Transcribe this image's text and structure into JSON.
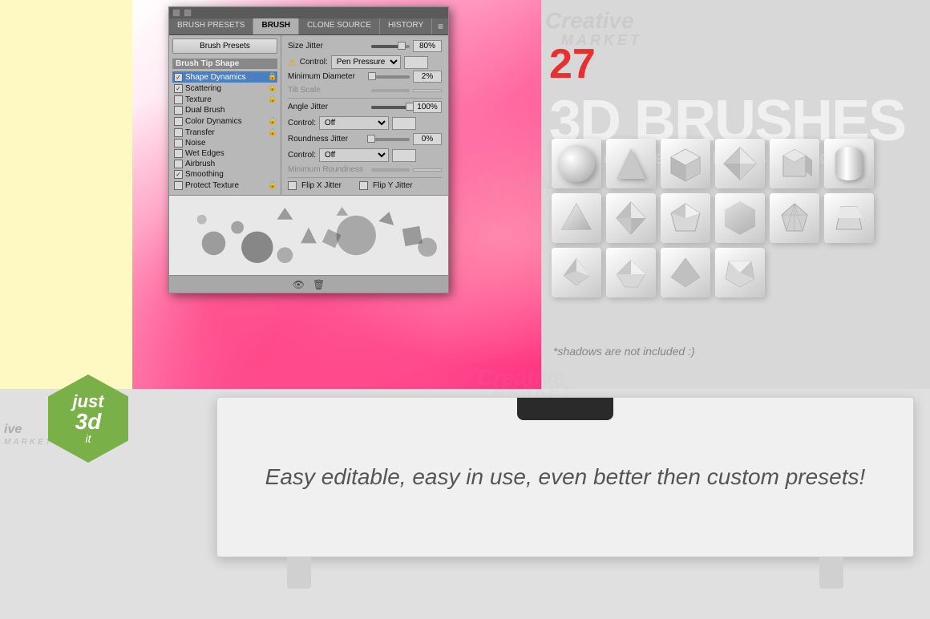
{
  "background": {
    "yellow_color": "#fef9c3",
    "pink_gradient": "pink polygonal",
    "gray_color": "#d8d8d8"
  },
  "creative_market": {
    "logo_text": "Creative",
    "market_text": "MARKET"
  },
  "brushes_title": {
    "number": "27",
    "main_title": "3D BRUSHES",
    "subtitle": "geometric shapes collection",
    "note": "*shadows are not included :)"
  },
  "badge": {
    "just_text": "just",
    "number": "3d",
    "it_text": "it"
  },
  "drawer": {
    "text": "Easy editable, easy in use, even better then custom presets!"
  },
  "ps_panel": {
    "tabs": [
      "BRUSH PRESETS",
      "BRUSH",
      "CLONE SOURCE",
      "HISTORY"
    ],
    "active_tab": "BRUSH",
    "brush_presets_btn": "Brush Presets",
    "section_title": "Brush Tip Shape",
    "options": [
      {
        "label": "Shape Dynamics",
        "checked": true,
        "has_lock": true,
        "selected": true
      },
      {
        "label": "Scattering",
        "checked": true,
        "has_lock": true,
        "selected": false
      },
      {
        "label": "Texture",
        "checked": false,
        "has_lock": true,
        "selected": false
      },
      {
        "label": "Dual Brush",
        "checked": false,
        "has_lock": false,
        "selected": false
      },
      {
        "label": "Color Dynamics",
        "checked": false,
        "has_lock": true,
        "selected": false
      },
      {
        "label": "Transfer",
        "checked": false,
        "has_lock": true,
        "selected": false
      },
      {
        "label": "Noise",
        "checked": false,
        "has_lock": false,
        "selected": false
      },
      {
        "label": "Wet Edges",
        "checked": false,
        "has_lock": false,
        "selected": false
      },
      {
        "label": "Airbrush",
        "checked": false,
        "has_lock": false,
        "selected": false
      },
      {
        "label": "Smoothing",
        "checked": true,
        "has_lock": false,
        "selected": false
      },
      {
        "label": "Protect Texture",
        "checked": false,
        "has_lock": false,
        "selected": false
      }
    ],
    "controls": {
      "size_jitter": {
        "label": "Size Jitter",
        "value": "80%",
        "percent": 80
      },
      "control_label": "Control:",
      "control_value": "Pen Pressure",
      "min_diameter": {
        "label": "Minimum Diameter",
        "value": "2%",
        "percent": 2
      },
      "tilt_scale": {
        "label": "Tilt Scale",
        "disabled": true
      },
      "angle_jitter": {
        "label": "Angle Jitter",
        "value": "100%",
        "percent": 100
      },
      "control2_value": "Off",
      "roundness_jitter": {
        "label": "Roundness Jitter",
        "value": "0%",
        "percent": 0
      },
      "control3_value": "Off",
      "min_roundness": {
        "label": "Minimum Roundness",
        "disabled": true
      },
      "flip_x": "Flip X Jitter",
      "flip_y": "Flip Y Jitter"
    }
  }
}
